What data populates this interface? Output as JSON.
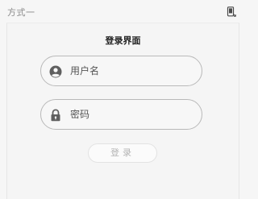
{
  "window": {
    "title": "方式一",
    "icon": "mobile-device-icon"
  },
  "login": {
    "title": "登录界面",
    "username": {
      "placeholder": "用户名",
      "value": "",
      "icon": "user-icon"
    },
    "password": {
      "placeholder": "密码",
      "value": "",
      "icon": "lock-icon"
    },
    "submit_label": "登录"
  },
  "colors": {
    "field_border": "#b9b9b9",
    "icon": "#5f5f5f",
    "button_text": "#b3b3b3"
  }
}
